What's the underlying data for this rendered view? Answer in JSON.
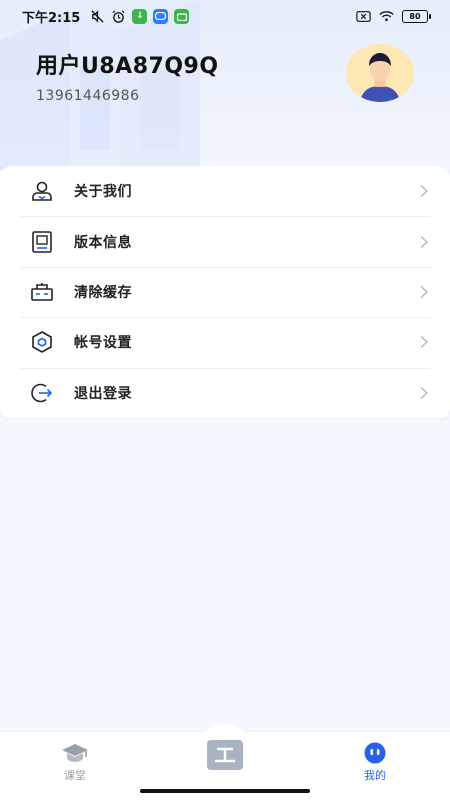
{
  "status_bar": {
    "time": "下午2:15",
    "battery": "80",
    "icons": [
      "mute-icon",
      "alarm-icon",
      "download-app-icon",
      "game-app-icon",
      "android-app-icon",
      "sim-x-icon",
      "wifi-icon",
      "battery-icon"
    ],
    "app_colors": {
      "download": "#3cb54a",
      "game": "#2d7ff9",
      "android": "#3cb54a"
    }
  },
  "profile": {
    "name": "用户U8A87Q9Q",
    "phone": "13961446986"
  },
  "menu": {
    "items": [
      {
        "label": "关于我们",
        "icon": "about-us-icon"
      },
      {
        "label": "版本信息",
        "icon": "version-info-icon"
      },
      {
        "label": "清除缓存",
        "icon": "clear-cache-icon"
      },
      {
        "label": "帐号设置",
        "icon": "account-settings-icon"
      },
      {
        "label": "退出登录",
        "icon": "logout-icon"
      }
    ]
  },
  "bottom_nav": {
    "items": [
      {
        "label": "课堂",
        "icon": "graduation-cap-icon",
        "active": false
      },
      {
        "label": "",
        "icon": "workbench-icon",
        "active": false
      },
      {
        "label": "我的",
        "icon": "robot-face-icon",
        "active": true
      }
    ],
    "active_color": "#2563eb",
    "inactive_color": "#9aa0a8"
  }
}
